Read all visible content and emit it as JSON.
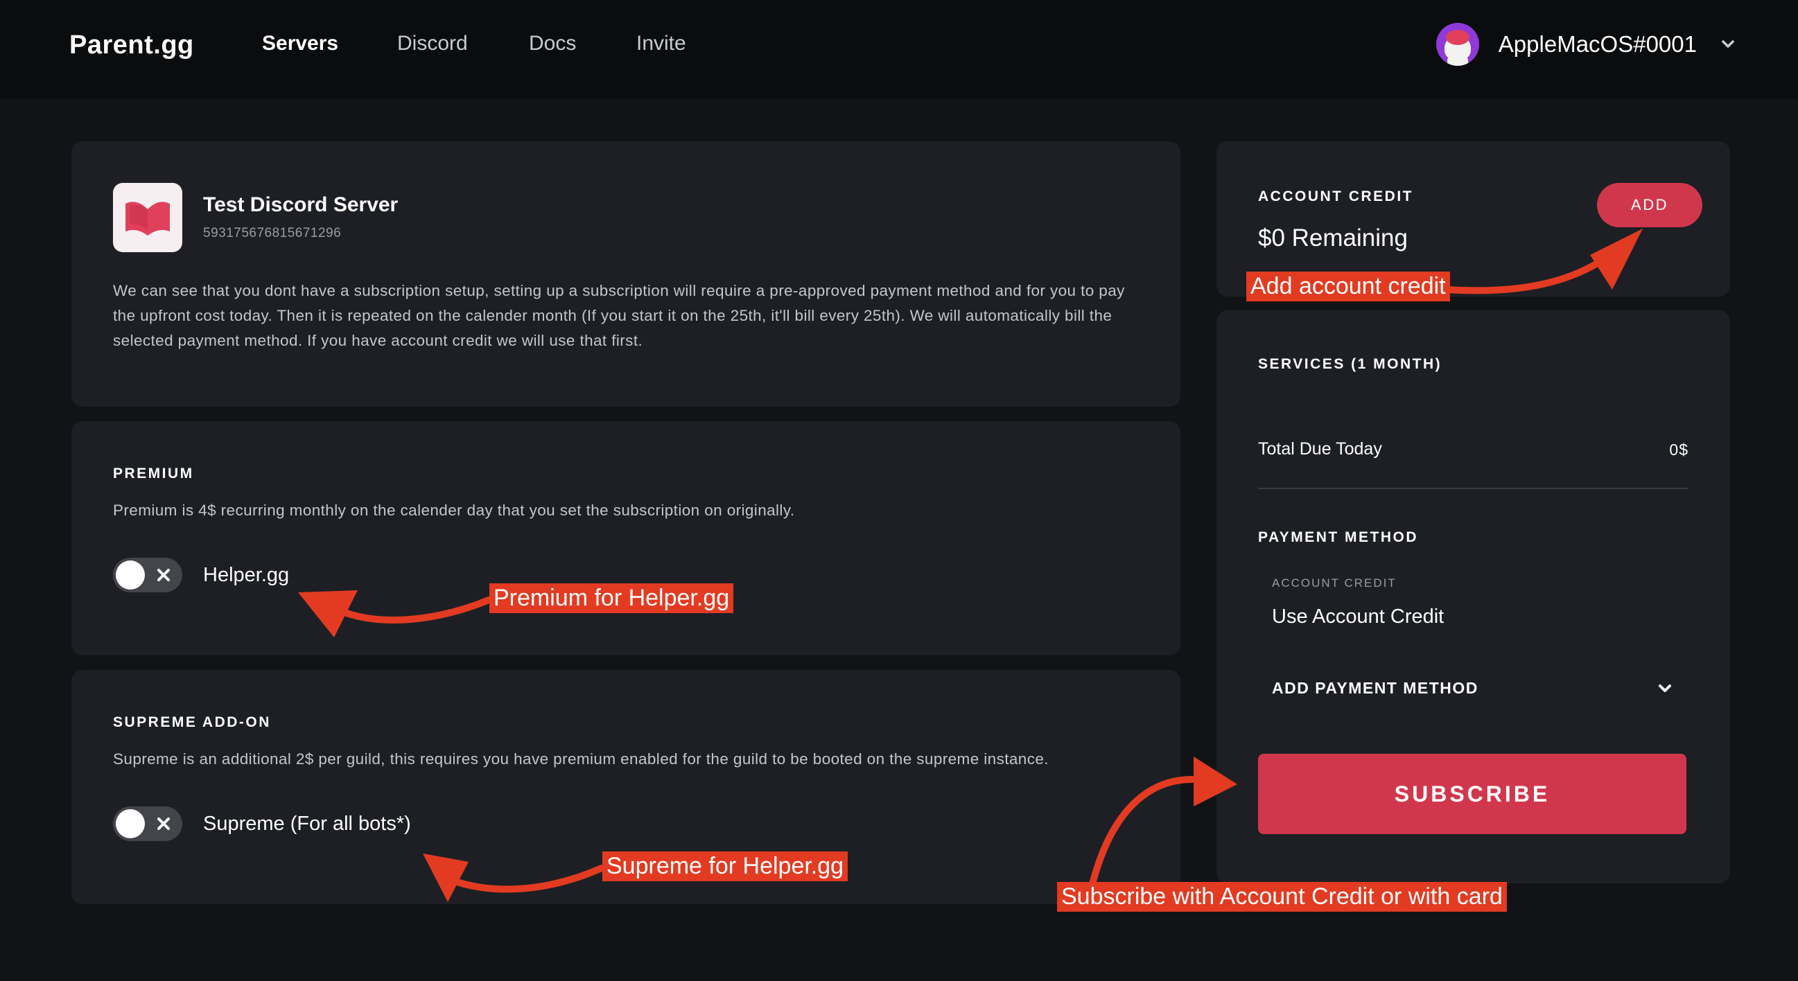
{
  "nav": {
    "brand": "Parent.gg",
    "links": [
      "Servers",
      "Discord",
      "Docs",
      "Invite"
    ],
    "username": "AppleMacOS#0001"
  },
  "server": {
    "name": "Test Discord Server",
    "id": "593175676815671296",
    "description": "We can see that you dont have a subscription setup, setting up a subscription will require a pre-approved payment method and for you to pay the upfront cost today. Then it is repeated on the calender month (If you start it on the 25th, it'll bill every 25th). We will automatically bill the selected payment method. If you have account credit we will use that first."
  },
  "premium": {
    "label": "PREMIUM",
    "description": "Premium is 4$ recurring monthly on the calender day that you set the subscription on originally.",
    "toggle_label": "Helper.gg",
    "enabled": false
  },
  "supreme": {
    "label": "SUPREME ADD-ON",
    "description": "Supreme is an additional 2$ per guild, this requires you have premium enabled for the guild to be booted on the supreme instance.",
    "toggle_label": "Supreme (For all bots*)",
    "enabled": false
  },
  "credit": {
    "label": "ACCOUNT CREDIT",
    "value": "$0 Remaining",
    "add_label": "ADD"
  },
  "services": {
    "label": "SERVICES (1 MONTH)",
    "due_label": "Total Due Today",
    "due_value": "0$",
    "payment_label": "PAYMENT METHOD",
    "payment_sub": "ACCOUNT CREDIT",
    "payment_use": "Use Account Credit",
    "payment_add": "ADD PAYMENT METHOD",
    "subscribe_label": "SUBSCRIBE"
  },
  "annotations": {
    "credit": "Add account credit",
    "premium": "Premium for Helper.gg",
    "supreme": "Supreme for Helper.gg",
    "subscribe": "Subscribe with Account Credit or with card"
  },
  "colors": {
    "background": "#121317",
    "card": "#1d1f24",
    "accent": "#d1374c",
    "annotation": "#e23b22"
  },
  "icons": [
    "server-logo-icon",
    "avatar",
    "chevron-down-icon",
    "close-icon"
  ]
}
